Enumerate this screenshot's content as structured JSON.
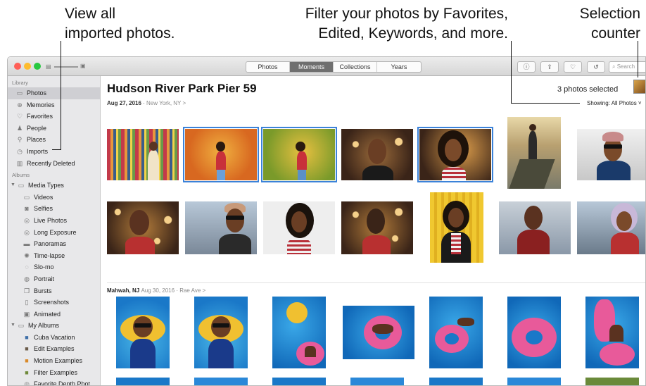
{
  "callouts": {
    "view_all": "View all\nimported photos.",
    "filter": "Filter your photos by Favorites,\nEdited, Keywords, and more.",
    "selection": "Selection\ncounter"
  },
  "toolbar": {
    "view_tabs": [
      "Photos",
      "Moments",
      "Collections",
      "Years"
    ],
    "active_tab": "Moments",
    "search_placeholder": "Search",
    "icons": [
      "info-icon",
      "share-icon",
      "heart-icon",
      "rotate-icon"
    ]
  },
  "sidebar": {
    "library_header": "Library",
    "library_items": [
      {
        "label": "Photos",
        "icon": "photos-icon",
        "selected": true
      },
      {
        "label": "Memories",
        "icon": "memories-icon"
      },
      {
        "label": "Favorites",
        "icon": "heart-icon"
      },
      {
        "label": "People",
        "icon": "person-icon"
      },
      {
        "label": "Places",
        "icon": "pin-icon"
      },
      {
        "label": "Imports",
        "icon": "clock-icon"
      },
      {
        "label": "Recently Deleted",
        "icon": "trash-icon"
      }
    ],
    "albums_header": "Albums",
    "media_types_label": "Media Types",
    "media_types": [
      {
        "label": "Videos",
        "icon": "video-icon"
      },
      {
        "label": "Selfies",
        "icon": "selfie-icon"
      },
      {
        "label": "Live Photos",
        "icon": "live-photo-icon"
      },
      {
        "label": "Long Exposure",
        "icon": "long-exposure-icon"
      },
      {
        "label": "Panoramas",
        "icon": "panorama-icon"
      },
      {
        "label": "Time-lapse",
        "icon": "timelapse-icon"
      },
      {
        "label": "Slo-mo",
        "icon": "slomo-icon"
      },
      {
        "label": "Portrait",
        "icon": "portrait-icon"
      },
      {
        "label": "Bursts",
        "icon": "burst-icon"
      },
      {
        "label": "Screenshots",
        "icon": "screenshot-icon"
      },
      {
        "label": "Animated",
        "icon": "animated-icon"
      }
    ],
    "my_albums_label": "My Albums",
    "my_albums": [
      {
        "label": "Cuba Vacation",
        "icon": "album-thumb-icon"
      },
      {
        "label": "Edit Examples",
        "icon": "album-thumb-icon"
      },
      {
        "label": "Motion Examples",
        "icon": "album-thumb-icon"
      },
      {
        "label": "Filter Examples",
        "icon": "album-thumb-icon"
      },
      {
        "label": "Favorite Depth Phot",
        "icon": "album-thumb-icon"
      }
    ]
  },
  "moment": {
    "title": "Hudson River Park Pier 59",
    "date": "Aug 27, 2016",
    "location": "New York, NY",
    "chevron": ">",
    "selection_text": "3 photos selected",
    "showing_text": "Showing: All Photos ˅"
  },
  "moment2": {
    "place": "Mahwah, NJ",
    "date": "Aug 30, 2016",
    "location": "Rae Ave",
    "chevron": ">"
  },
  "colors": {
    "selection_outline": "#3b82d9",
    "active_tab": "#6f6f6f",
    "sidebar_bg": "#e8e8ea",
    "traffic_red": "#ff5f57",
    "traffic_yellow": "#febc2e",
    "traffic_green": "#28c840"
  }
}
